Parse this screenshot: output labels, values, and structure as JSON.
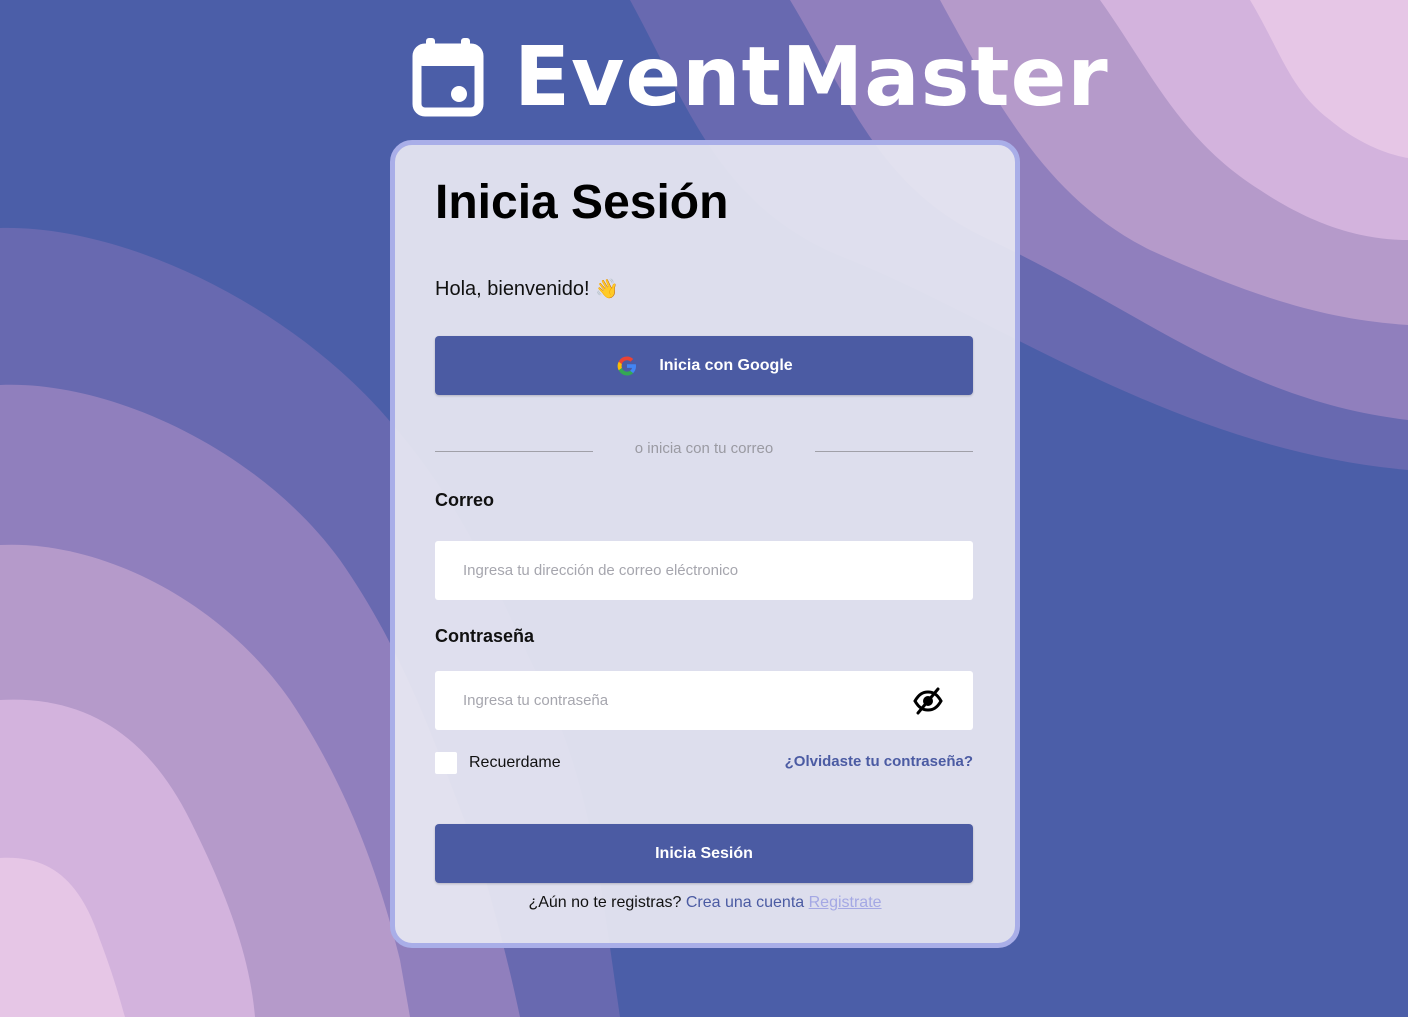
{
  "app": {
    "brand_name": "EventMaster",
    "brand_icon": "calendar-icon"
  },
  "login": {
    "title": "Inicia Sesión",
    "greeting": "Hola, bienvenido!",
    "greeting_emoji": "👋",
    "google_button_label": "Inicia con Google",
    "google_icon": "google-icon",
    "divider_text": "o inicia con tu correo",
    "email": {
      "label": "Correo",
      "placeholder": "Ingresa tu dirección de correo eléctronico",
      "value": ""
    },
    "password": {
      "label": "Contraseña",
      "placeholder": "Ingresa tu contraseña",
      "value": "",
      "toggle_icon": "eye-off-icon"
    },
    "remember_label": "Recuerdame",
    "remember_checked": false,
    "forgot_link": "¿Olvidaste tu contraseña?",
    "submit_label": "Inicia Sesión",
    "signup_prompt": "¿Aún no te registras?",
    "signup_link": "Crea una cuenta",
    "signup_secondary_link": "Registrate"
  },
  "colors": {
    "primary": "#4b5ba3",
    "card_border": "#a9aee8",
    "background_bands": [
      "#4b5ea8",
      "#6869b0",
      "#907fbd",
      "#b59aca",
      "#d3b3dd",
      "#e6c6e6"
    ]
  }
}
